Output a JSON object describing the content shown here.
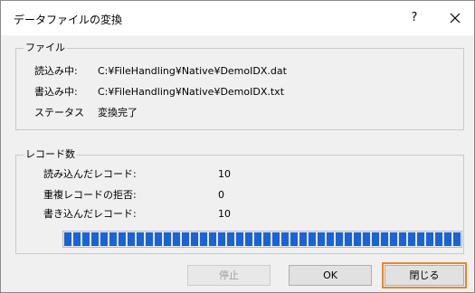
{
  "window": {
    "title": "データファイルの変換",
    "help_label": "?"
  },
  "file_group": {
    "legend": "ファイル",
    "read_label": "読込み中:",
    "read_value": "C:¥FileHandling¥Native¥DemoIDX.dat",
    "write_label": "書込み中:",
    "write_value": "C:¥FileHandling¥Native¥DemoIDX.txt",
    "status_label": "ステータス",
    "status_value": "変換完了"
  },
  "record_group": {
    "legend": "レコード数",
    "read_records_label": "読み込んだレコード:",
    "read_records_value": "10",
    "rejected_label": "重複レコードの拒否:",
    "rejected_value": "0",
    "written_label": "書き込んだレコード:",
    "written_value": "10",
    "progress_fraction": 1.0,
    "progress_color": "#1a63d6"
  },
  "buttons": {
    "stop_label": "停止",
    "ok_label": "OK",
    "close_label": "閉じる",
    "highlight_color": "#e8862c"
  }
}
